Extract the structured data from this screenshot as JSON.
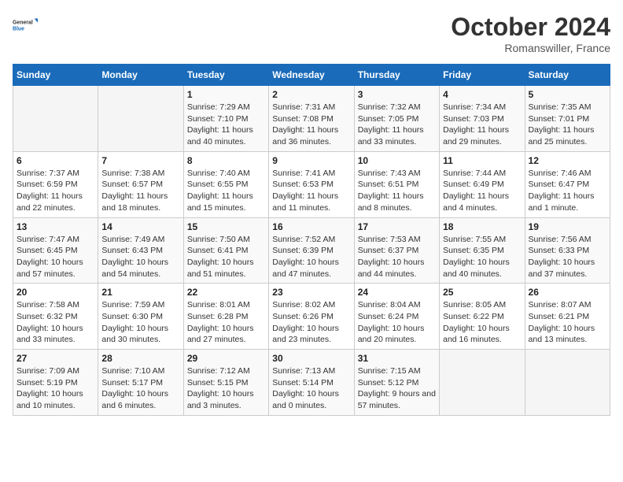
{
  "logo": {
    "text_general": "General",
    "text_blue": "Blue"
  },
  "title": "October 2024",
  "location": "Romanswiller, France",
  "days_of_week": [
    "Sunday",
    "Monday",
    "Tuesday",
    "Wednesday",
    "Thursday",
    "Friday",
    "Saturday"
  ],
  "weeks": [
    [
      {
        "num": "",
        "sunrise": "",
        "sunset": "",
        "daylight": ""
      },
      {
        "num": "",
        "sunrise": "",
        "sunset": "",
        "daylight": ""
      },
      {
        "num": "1",
        "sunrise": "Sunrise: 7:29 AM",
        "sunset": "Sunset: 7:10 PM",
        "daylight": "Daylight: 11 hours and 40 minutes."
      },
      {
        "num": "2",
        "sunrise": "Sunrise: 7:31 AM",
        "sunset": "Sunset: 7:08 PM",
        "daylight": "Daylight: 11 hours and 36 minutes."
      },
      {
        "num": "3",
        "sunrise": "Sunrise: 7:32 AM",
        "sunset": "Sunset: 7:05 PM",
        "daylight": "Daylight: 11 hours and 33 minutes."
      },
      {
        "num": "4",
        "sunrise": "Sunrise: 7:34 AM",
        "sunset": "Sunset: 7:03 PM",
        "daylight": "Daylight: 11 hours and 29 minutes."
      },
      {
        "num": "5",
        "sunrise": "Sunrise: 7:35 AM",
        "sunset": "Sunset: 7:01 PM",
        "daylight": "Daylight: 11 hours and 25 minutes."
      }
    ],
    [
      {
        "num": "6",
        "sunrise": "Sunrise: 7:37 AM",
        "sunset": "Sunset: 6:59 PM",
        "daylight": "Daylight: 11 hours and 22 minutes."
      },
      {
        "num": "7",
        "sunrise": "Sunrise: 7:38 AM",
        "sunset": "Sunset: 6:57 PM",
        "daylight": "Daylight: 11 hours and 18 minutes."
      },
      {
        "num": "8",
        "sunrise": "Sunrise: 7:40 AM",
        "sunset": "Sunset: 6:55 PM",
        "daylight": "Daylight: 11 hours and 15 minutes."
      },
      {
        "num": "9",
        "sunrise": "Sunrise: 7:41 AM",
        "sunset": "Sunset: 6:53 PM",
        "daylight": "Daylight: 11 hours and 11 minutes."
      },
      {
        "num": "10",
        "sunrise": "Sunrise: 7:43 AM",
        "sunset": "Sunset: 6:51 PM",
        "daylight": "Daylight: 11 hours and 8 minutes."
      },
      {
        "num": "11",
        "sunrise": "Sunrise: 7:44 AM",
        "sunset": "Sunset: 6:49 PM",
        "daylight": "Daylight: 11 hours and 4 minutes."
      },
      {
        "num": "12",
        "sunrise": "Sunrise: 7:46 AM",
        "sunset": "Sunset: 6:47 PM",
        "daylight": "Daylight: 11 hours and 1 minute."
      }
    ],
    [
      {
        "num": "13",
        "sunrise": "Sunrise: 7:47 AM",
        "sunset": "Sunset: 6:45 PM",
        "daylight": "Daylight: 10 hours and 57 minutes."
      },
      {
        "num": "14",
        "sunrise": "Sunrise: 7:49 AM",
        "sunset": "Sunset: 6:43 PM",
        "daylight": "Daylight: 10 hours and 54 minutes."
      },
      {
        "num": "15",
        "sunrise": "Sunrise: 7:50 AM",
        "sunset": "Sunset: 6:41 PM",
        "daylight": "Daylight: 10 hours and 51 minutes."
      },
      {
        "num": "16",
        "sunrise": "Sunrise: 7:52 AM",
        "sunset": "Sunset: 6:39 PM",
        "daylight": "Daylight: 10 hours and 47 minutes."
      },
      {
        "num": "17",
        "sunrise": "Sunrise: 7:53 AM",
        "sunset": "Sunset: 6:37 PM",
        "daylight": "Daylight: 10 hours and 44 minutes."
      },
      {
        "num": "18",
        "sunrise": "Sunrise: 7:55 AM",
        "sunset": "Sunset: 6:35 PM",
        "daylight": "Daylight: 10 hours and 40 minutes."
      },
      {
        "num": "19",
        "sunrise": "Sunrise: 7:56 AM",
        "sunset": "Sunset: 6:33 PM",
        "daylight": "Daylight: 10 hours and 37 minutes."
      }
    ],
    [
      {
        "num": "20",
        "sunrise": "Sunrise: 7:58 AM",
        "sunset": "Sunset: 6:32 PM",
        "daylight": "Daylight: 10 hours and 33 minutes."
      },
      {
        "num": "21",
        "sunrise": "Sunrise: 7:59 AM",
        "sunset": "Sunset: 6:30 PM",
        "daylight": "Daylight: 10 hours and 30 minutes."
      },
      {
        "num": "22",
        "sunrise": "Sunrise: 8:01 AM",
        "sunset": "Sunset: 6:28 PM",
        "daylight": "Daylight: 10 hours and 27 minutes."
      },
      {
        "num": "23",
        "sunrise": "Sunrise: 8:02 AM",
        "sunset": "Sunset: 6:26 PM",
        "daylight": "Daylight: 10 hours and 23 minutes."
      },
      {
        "num": "24",
        "sunrise": "Sunrise: 8:04 AM",
        "sunset": "Sunset: 6:24 PM",
        "daylight": "Daylight: 10 hours and 20 minutes."
      },
      {
        "num": "25",
        "sunrise": "Sunrise: 8:05 AM",
        "sunset": "Sunset: 6:22 PM",
        "daylight": "Daylight: 10 hours and 16 minutes."
      },
      {
        "num": "26",
        "sunrise": "Sunrise: 8:07 AM",
        "sunset": "Sunset: 6:21 PM",
        "daylight": "Daylight: 10 hours and 13 minutes."
      }
    ],
    [
      {
        "num": "27",
        "sunrise": "Sunrise: 7:09 AM",
        "sunset": "Sunset: 5:19 PM",
        "daylight": "Daylight: 10 hours and 10 minutes."
      },
      {
        "num": "28",
        "sunrise": "Sunrise: 7:10 AM",
        "sunset": "Sunset: 5:17 PM",
        "daylight": "Daylight: 10 hours and 6 minutes."
      },
      {
        "num": "29",
        "sunrise": "Sunrise: 7:12 AM",
        "sunset": "Sunset: 5:15 PM",
        "daylight": "Daylight: 10 hours and 3 minutes."
      },
      {
        "num": "30",
        "sunrise": "Sunrise: 7:13 AM",
        "sunset": "Sunset: 5:14 PM",
        "daylight": "Daylight: 10 hours and 0 minutes."
      },
      {
        "num": "31",
        "sunrise": "Sunrise: 7:15 AM",
        "sunset": "Sunset: 5:12 PM",
        "daylight": "Daylight: 9 hours and 57 minutes."
      },
      {
        "num": "",
        "sunrise": "",
        "sunset": "",
        "daylight": ""
      },
      {
        "num": "",
        "sunrise": "",
        "sunset": "",
        "daylight": ""
      }
    ]
  ]
}
